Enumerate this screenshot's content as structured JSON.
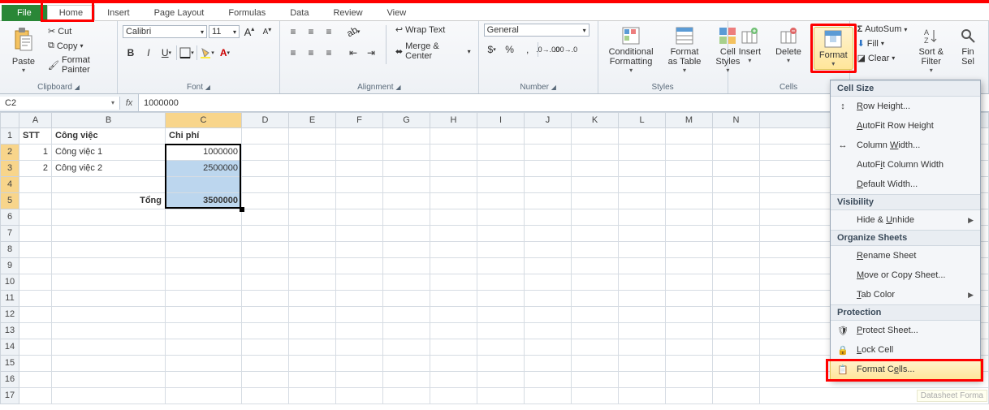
{
  "tabs": {
    "file": "File",
    "home": "Home",
    "insert": "Insert",
    "page_layout": "Page Layout",
    "formulas": "Formulas",
    "data": "Data",
    "review": "Review",
    "view": "View"
  },
  "ribbon": {
    "clipboard": {
      "label": "Clipboard",
      "paste": "Paste",
      "cut": "Cut",
      "copy": "Copy",
      "painter": "Format Painter"
    },
    "font": {
      "label": "Font",
      "name": "Calibri",
      "size": "11"
    },
    "alignment": {
      "label": "Alignment",
      "wrap": "Wrap Text",
      "merge": "Merge & Center"
    },
    "number": {
      "label": "Number",
      "format": "General"
    },
    "styles": {
      "label": "Styles",
      "cond": "Conditional\nFormatting",
      "table": "Format\nas Table",
      "cell": "Cell\nStyles"
    },
    "cells": {
      "label": "Cells",
      "insert": "Insert",
      "delete": "Delete",
      "format": "Format"
    },
    "editing": {
      "autosum": "AutoSum",
      "fill": "Fill",
      "clear": "Clear",
      "sort": "Sort &\nFilter",
      "find": "Fin\nSel"
    }
  },
  "namebox": "C2",
  "formula": "1000000",
  "columns": [
    "A",
    "B",
    "C",
    "D",
    "E",
    "F",
    "G",
    "H",
    "I",
    "J",
    "K",
    "L",
    "M",
    "N"
  ],
  "rows": 17,
  "sel_cols": [
    "C"
  ],
  "sel_rows": [
    2,
    3,
    4,
    5
  ],
  "data": {
    "1": {
      "A": "STT",
      "B": "Công việc",
      "C": "Chi phí"
    },
    "2": {
      "A": "1",
      "B": "Công việc 1",
      "C": "1000000"
    },
    "3": {
      "A": "2",
      "B": "Công việc 2",
      "C": "2500000"
    },
    "5": {
      "B": "Tổng",
      "C": "3500000"
    }
  },
  "right_align": {
    "2": [
      "A",
      "C"
    ],
    "3": [
      "A",
      "C"
    ],
    "5": [
      "B",
      "C"
    ]
  },
  "bold_cells": {
    "1": [
      "A",
      "B",
      "C"
    ],
    "5": [
      "B",
      "C"
    ]
  },
  "menu": {
    "cell_size": "Cell Size",
    "row_height": "Row Height...",
    "autofit_row": "AutoFit Row Height",
    "col_width": "Column Width...",
    "autofit_col": "AutoFit Column Width",
    "default_width": "Default Width...",
    "visibility": "Visibility",
    "hide": "Hide & Unhide",
    "organize": "Organize Sheets",
    "rename": "Rename Sheet",
    "move": "Move or Copy Sheet...",
    "tab_color": "Tab Color",
    "protection": "Protection",
    "protect": "Protect Sheet...",
    "lock": "Lock Cell",
    "format_cells": "Format Cells..."
  },
  "tooltip": "Datasheet Forma"
}
